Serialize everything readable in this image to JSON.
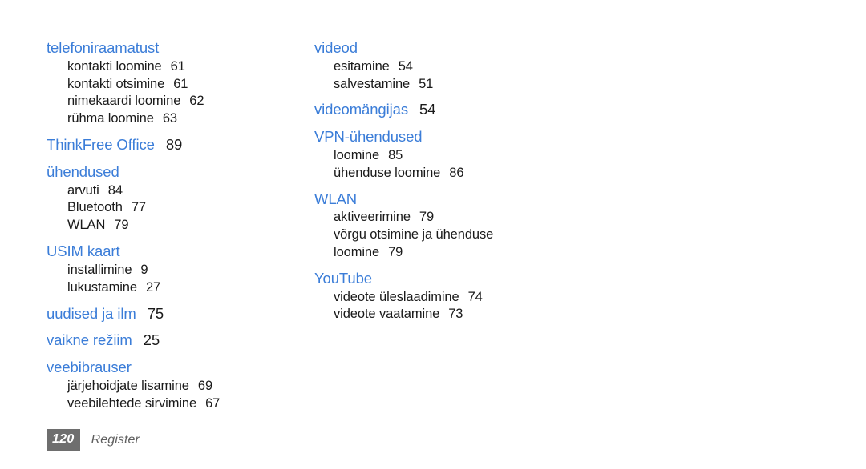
{
  "document": {
    "page_number": "120",
    "section_label": "Register",
    "heading_color": "#3b7dd8",
    "text_color": "#1a1a1a",
    "badge_color": "#6e6e6e"
  },
  "columns": [
    {
      "name": "left",
      "groups": [
        {
          "heading": "telefoniraamatust",
          "heading_page": "",
          "subentries": [
            {
              "label": "kontakti loomine",
              "page": "61"
            },
            {
              "label": "kontakti otsimine",
              "page": "61"
            },
            {
              "label": "nimekaardi loomine",
              "page": "62"
            },
            {
              "label": "rühma loomine",
              "page": "63"
            }
          ]
        },
        {
          "heading": "ThinkFree Office",
          "heading_page": "89",
          "subentries": []
        },
        {
          "heading": "ühendused",
          "heading_page": "",
          "subentries": [
            {
              "label": "arvuti",
              "page": "84"
            },
            {
              "label": "Bluetooth",
              "page": "77"
            },
            {
              "label": "WLAN",
              "page": "79"
            }
          ]
        },
        {
          "heading": "USIM kaart",
          "heading_page": "",
          "subentries": [
            {
              "label": "installimine",
              "page": "9"
            },
            {
              "label": "lukustamine",
              "page": "27"
            }
          ]
        },
        {
          "heading": "uudised ja ilm",
          "heading_page": "75",
          "subentries": []
        },
        {
          "heading": "vaikne režiim",
          "heading_page": "25",
          "subentries": []
        },
        {
          "heading": "veebibrauser",
          "heading_page": "",
          "subentries": [
            {
              "label": "järjehoidjate lisamine",
              "page": "69"
            },
            {
              "label": "veebilehtede sirvimine",
              "page": "67"
            }
          ]
        }
      ]
    },
    {
      "name": "right",
      "groups": [
        {
          "heading": "videod",
          "heading_page": "",
          "subentries": [
            {
              "label": "esitamine",
              "page": "54"
            },
            {
              "label": "salvestamine",
              "page": "51"
            }
          ]
        },
        {
          "heading": "videomängijas",
          "heading_page": "54",
          "subentries": []
        },
        {
          "heading": "VPN-ühendused",
          "heading_page": "",
          "subentries": [
            {
              "label": "loomine",
              "page": "85"
            },
            {
              "label": "ühenduse loomine",
              "page": "86"
            }
          ]
        },
        {
          "heading": "WLAN",
          "heading_page": "",
          "subentries": [
            {
              "label": "aktiveerimine",
              "page": "79"
            },
            {
              "label": "võrgu otsimine ja ühenduse loomine",
              "page": "79",
              "wrapped": true
            }
          ]
        },
        {
          "heading": "YouTube",
          "heading_page": "",
          "subentries": [
            {
              "label": "videote üleslaadimine",
              "page": "74"
            },
            {
              "label": "videote vaatamine",
              "page": "73"
            }
          ]
        }
      ]
    }
  ]
}
